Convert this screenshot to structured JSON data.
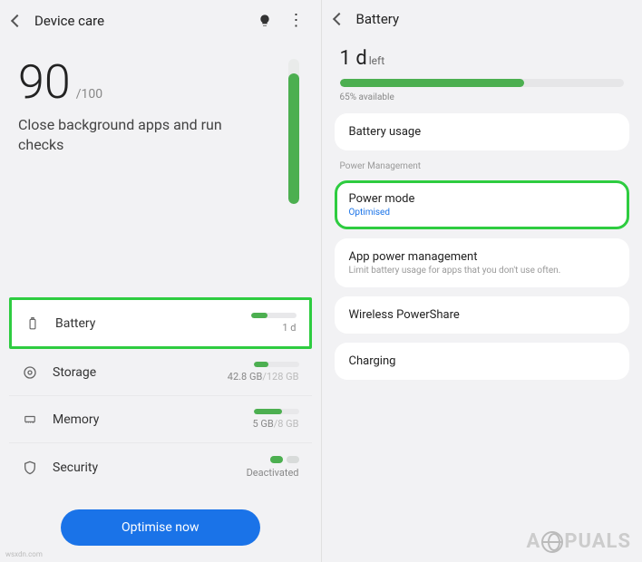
{
  "left": {
    "title": "Device care",
    "score": "90",
    "score_max": "/100",
    "subtitle": "Close background apps and run checks",
    "vbar_percent": 90,
    "rows": {
      "battery": {
        "label": "Battery",
        "value": "1 d",
        "bar_percent": 36
      },
      "storage": {
        "label": "Storage",
        "used": "42.8 GB",
        "total": "/128 GB",
        "bar_percent": 33
      },
      "memory": {
        "label": "Memory",
        "used": "5 GB",
        "total": "/8 GB",
        "bar_percent": 62
      },
      "security": {
        "label": "Security",
        "value": "Deactivated"
      }
    },
    "optimise_btn": "Optimise now"
  },
  "right": {
    "title": "Battery",
    "time_value": "1 d",
    "time_suffix": "left",
    "bar_percent": 65,
    "available": "65% available",
    "cards": {
      "battery_usage": "Battery usage",
      "section": "Power Management",
      "power_mode": {
        "label": "Power mode",
        "sub": "Optimised"
      },
      "app_power": {
        "label": "App power management",
        "sub": "Limit battery usage for apps that you don't use often."
      },
      "wireless": "Wireless PowerShare",
      "charging": "Charging"
    }
  },
  "watermark": {
    "pre": "A",
    "post": "PUALS"
  },
  "source": "wsxdn.com"
}
